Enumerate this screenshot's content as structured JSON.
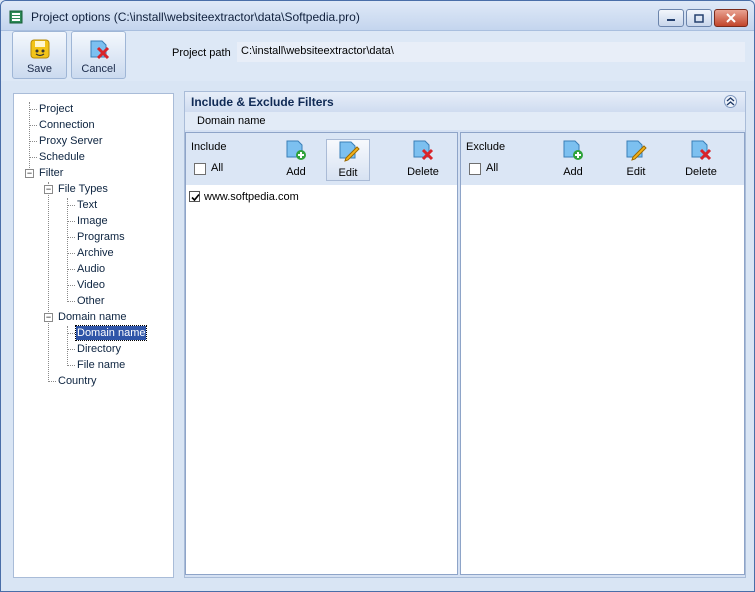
{
  "window": {
    "title": "Project options (C:\\install\\websiteextractor\\data\\Softpedia.pro)",
    "title_icon": "app-icon"
  },
  "toolbar": {
    "save_label": "Save",
    "cancel_label": "Cancel",
    "project_path_label": "Project path",
    "project_path_value": "C:\\install\\websiteextractor\\data\\"
  },
  "tree": {
    "items": [
      {
        "label": "Project"
      },
      {
        "label": "Connection"
      },
      {
        "label": "Proxy Server"
      },
      {
        "label": "Schedule"
      },
      {
        "label": "Filter"
      },
      {
        "label": "File Types"
      },
      {
        "label": "Text"
      },
      {
        "label": "Image"
      },
      {
        "label": "Programs"
      },
      {
        "label": "Archive"
      },
      {
        "label": "Audio"
      },
      {
        "label": "Video"
      },
      {
        "label": "Other"
      },
      {
        "label": "Domain name"
      },
      {
        "label": "Domain name"
      },
      {
        "label": "Directory"
      },
      {
        "label": "File name"
      },
      {
        "label": "Country"
      }
    ],
    "selected": "Domain name"
  },
  "panel": {
    "title": "Include & Exclude Filters",
    "subheader": "Domain name",
    "include": {
      "caption": "Include",
      "all_label": "All",
      "all_checked": false,
      "add_label": "Add",
      "edit_label": "Edit",
      "delete_label": "Delete",
      "items": [
        {
          "text": "www.softpedia.com",
          "checked": true
        }
      ]
    },
    "exclude": {
      "caption": "Exclude",
      "all_label": "All",
      "all_checked": false,
      "add_label": "Add",
      "edit_label": "Edit",
      "delete_label": "Delete",
      "items": []
    }
  },
  "colors": {
    "selection": "#2f55a8",
    "title_bar": "#c4d5ee",
    "delete_red": "#d8242a",
    "add_green": "#2fa23a"
  }
}
